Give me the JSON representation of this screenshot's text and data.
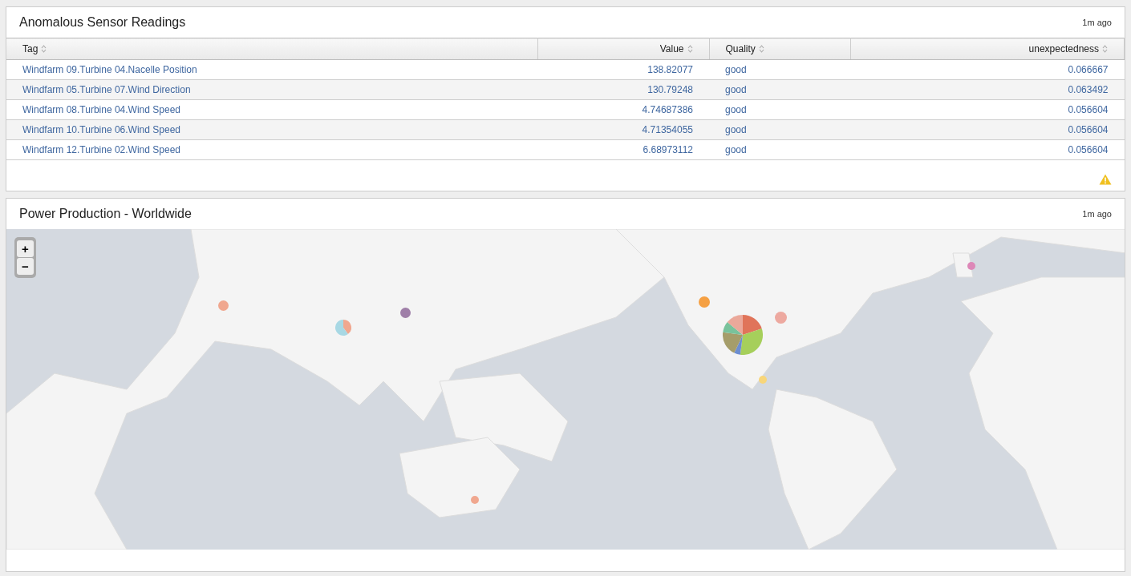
{
  "panels": [
    {
      "title": "Anomalous Sensor Readings",
      "updated": "1m ago",
      "table": {
        "columns": [
          "Tag",
          "Value",
          "Quality",
          "unexpectedness"
        ],
        "rows": [
          [
            "Windfarm 09.Turbine 04.Nacelle Position",
            "138.82077",
            "good",
            "0.066667"
          ],
          [
            "Windfarm 05.Turbine 07.Wind Direction",
            "130.79248",
            "good",
            "0.063492"
          ],
          [
            "Windfarm 08.Turbine 04.Wind Speed",
            "4.74687386",
            "good",
            "0.056604"
          ],
          [
            "Windfarm 10.Turbine 06.Wind Speed",
            "4.71354055",
            "good",
            "0.056604"
          ],
          [
            "Windfarm 12.Turbine 02.Wind Speed",
            "6.68973112",
            "good",
            "0.056604"
          ]
        ]
      }
    },
    {
      "title": "Power Production - Worldwide",
      "updated": "1m ago",
      "map": {
        "zoom_in": "+",
        "zoom_out": "−",
        "markers": [
          {
            "kind": "dot",
            "color": "#f0a78f"
          },
          {
            "kind": "pie"
          },
          {
            "kind": "dot",
            "color": "#9f7fa8"
          },
          {
            "kind": "dot",
            "color": "#f5a043"
          },
          {
            "kind": "pie"
          },
          {
            "kind": "dot",
            "color": "#eda9a0"
          },
          {
            "kind": "dot",
            "color": "#f8d67a"
          },
          {
            "kind": "dot",
            "color": "#dd88b8"
          },
          {
            "kind": "dot",
            "color": "#f0a78f"
          }
        ]
      }
    }
  ]
}
